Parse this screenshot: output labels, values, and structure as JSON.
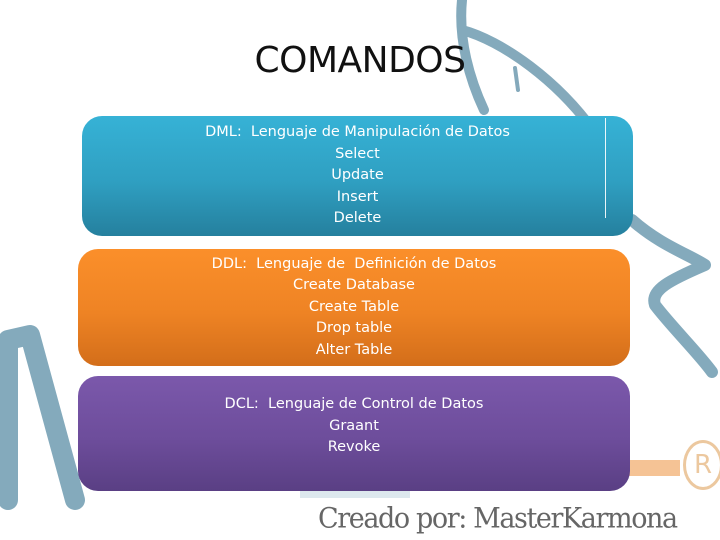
{
  "slide": {
    "title": "COMANDOS",
    "footer": "Creado por: MasterKarmona",
    "trademark_symbol": "R"
  },
  "colors": {
    "dml": "#2f9fc1",
    "ddl": "#ee8324",
    "dcl": "#6d4d9b",
    "watermark": "#6f9bb0"
  },
  "sections": [
    {
      "heading": "DML:  Lenguaje de Manipulación de Datos",
      "items": [
        "Select",
        "Update",
        "Insert",
        "Delete"
      ]
    },
    {
      "heading": "DDL:  Lenguaje de  Definición de Datos",
      "items": [
        "Create Database",
        "Create Table",
        "Drop table",
        "Alter Table"
      ]
    },
    {
      "heading": "DCL:  Lenguaje de Control de Datos",
      "items": [
        "Graant",
        "Revoke"
      ]
    }
  ]
}
